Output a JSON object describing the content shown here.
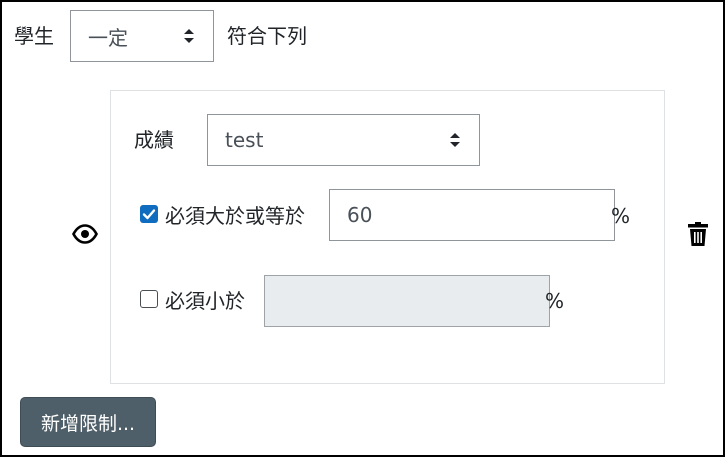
{
  "header": {
    "student_label": "學生",
    "condition_select": {
      "value": "一定"
    },
    "suffix_label": "符合下列"
  },
  "restriction": {
    "grade_label": "成績",
    "grade_select": {
      "value": "test"
    },
    "min": {
      "checked": true,
      "label": "必須大於或等於",
      "value": "60",
      "unit": "%"
    },
    "max": {
      "checked": false,
      "label": "必須小於",
      "value": "",
      "unit": "%"
    },
    "visibility_icon": "eye-icon",
    "delete_icon": "trash-icon"
  },
  "add_button": {
    "label": "新增限制..."
  }
}
